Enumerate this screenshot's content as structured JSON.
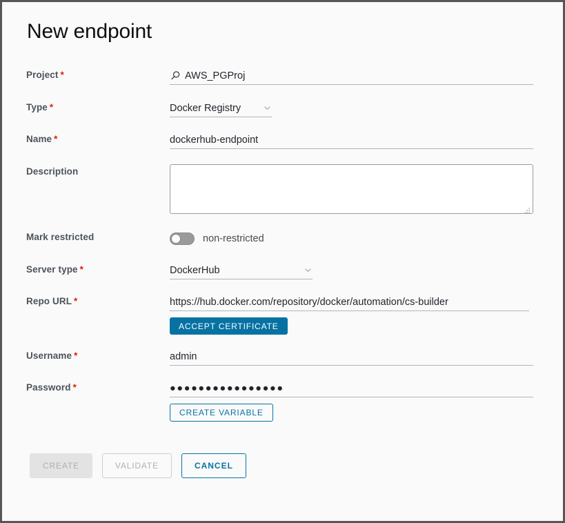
{
  "window": {
    "title": "New endpoint"
  },
  "colors": {
    "accent_blue": "#0672a3",
    "required_asterisk": "#e02200",
    "label_text": "#4c5259",
    "value_text": "#21252b",
    "page_background": "#fafafa",
    "window_border": "#565656",
    "input_underline": "#b3b3b3",
    "toggle_track_off": "#9a9a9a",
    "disabled_button_fill": "#e3e3e3",
    "disabled_button_text": "#aeaeae"
  },
  "form": {
    "project": {
      "label": "Project",
      "required": "*",
      "value": "AWS_PGProj",
      "icon": "search-icon"
    },
    "type": {
      "label": "Type",
      "required": "*",
      "value": "Docker Registry",
      "icon": "chevron-down-icon"
    },
    "name": {
      "label": "Name",
      "required": "*",
      "value": "dockerhub-endpoint"
    },
    "description": {
      "label": "Description",
      "value": "",
      "placeholder": ""
    },
    "mark_restricted": {
      "label": "Mark restricted",
      "toggle_state": "off",
      "state_label": "non-restricted"
    },
    "server_type": {
      "label": "Server type",
      "required": "*",
      "value": "DockerHub",
      "icon": "chevron-down-icon"
    },
    "repo_url": {
      "label": "Repo URL",
      "required": "*",
      "value": "https://hub.docker.com/repository/docker/automation/cs-builder",
      "action_button": "ACCEPT CERTIFICATE"
    },
    "username": {
      "label": "Username",
      "required": "*",
      "value": "admin"
    },
    "password": {
      "label": "Password",
      "required": "*",
      "value": "●●●●●●●●●●●●●●●●",
      "action_button": "CREATE VARIABLE"
    }
  },
  "actions": {
    "create": "CREATE",
    "validate": "VALIDATE",
    "cancel": "CANCEL"
  }
}
